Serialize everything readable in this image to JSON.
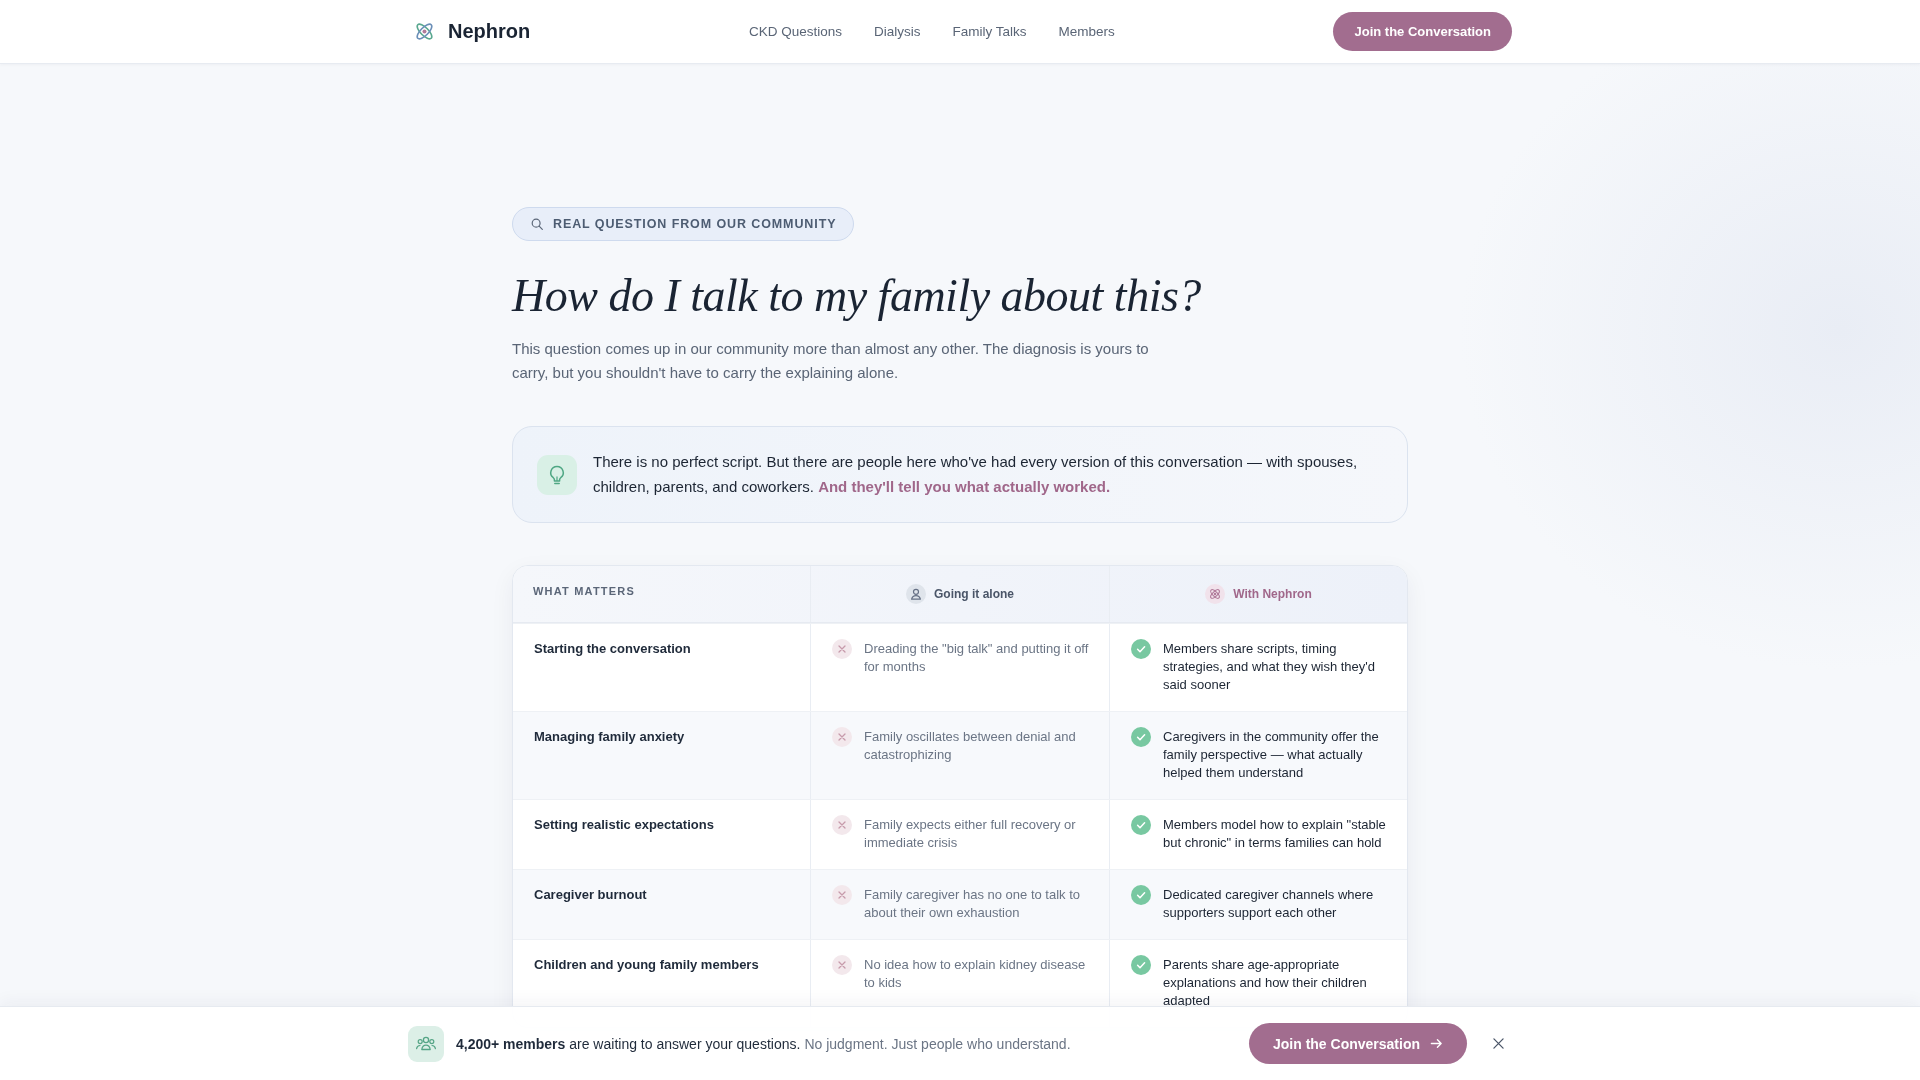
{
  "header": {
    "brand": "Nephron",
    "nav": [
      {
        "label": "CKD Questions"
      },
      {
        "label": "Dialysis"
      },
      {
        "label": "Family Talks"
      },
      {
        "label": "Members"
      }
    ],
    "cta": "Join the Conversation"
  },
  "hero": {
    "tag": "REAL QUESTION FROM OUR COMMUNITY",
    "title": "How do I talk to my family about this?",
    "intro": "This question comes up in our community more than almost any other. The diagnosis is yours to carry, but you shouldn't have to carry the explaining alone."
  },
  "callout": {
    "text": "There is no perfect script. But there are people here who've had every version of this conversation — with spouses, children, parents, and coworkers. **And they'll tell you what actually worked.**"
  },
  "comparison": {
    "columns": [
      {
        "kind": "topic",
        "label": "WHAT MATTERS"
      },
      {
        "kind": "alone",
        "label": "Going it alone"
      },
      {
        "kind": "nephron",
        "label": "With Nephron"
      }
    ],
    "rows": [
      {
        "cells": [
          "Starting the conversation",
          "Dreading the \"big talk\" and putting it off for months",
          "Members share scripts, timing strategies, and what they wish they'd said sooner"
        ]
      },
      {
        "cells": [
          "Managing family anxiety",
          "Family oscillates between denial and catastrophizing",
          "Caregivers in the community offer the family perspective — what actually helped them understand"
        ]
      },
      {
        "cells": [
          "Setting realistic expectations",
          "Family expects either full recovery or immediate crisis",
          "Members model how to explain \"stable but chronic\" in terms families can hold"
        ]
      },
      {
        "cells": [
          "Caregiver burnout",
          "Family caregiver has no one to talk to about their own exhaustion",
          "Dedicated caregiver channels where supporters support each other"
        ]
      },
      {
        "cells": [
          "Children and young family members",
          "No idea how to explain kidney disease to kids",
          "Parents share age-appropriate explanations and how their children adapted"
        ]
      }
    ]
  },
  "join_bar": {
    "message": "**4,200+ members** are waiting to answer your questions.",
    "note": "No judgment. Just people who understand.",
    "button": "Join the Conversation"
  }
}
